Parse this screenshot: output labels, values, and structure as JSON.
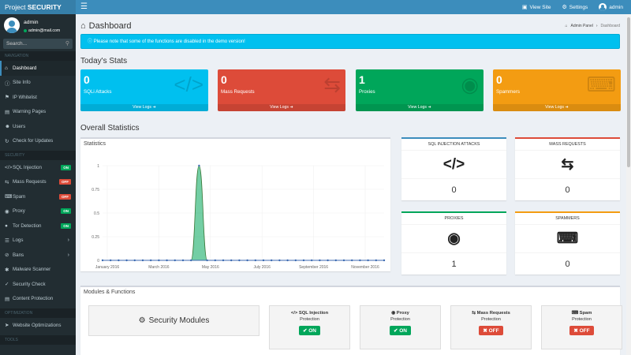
{
  "brand": {
    "prefix": "Project ",
    "strong": "SECURITY"
  },
  "topnav": {
    "toggle_icon": "menu-icon",
    "view_site": "View Site",
    "settings": "Settings",
    "user": "admin"
  },
  "user": {
    "name": "admin",
    "email": "admin@mail.com"
  },
  "search": {
    "placeholder": "Search..."
  },
  "sidebar": {
    "headers": {
      "navigation": "NAVIGATION",
      "security": "SECURITY",
      "optimization": "OPTIMIZATION",
      "tools": "TOOLS"
    },
    "nav_items": [
      {
        "label": "Dashboard",
        "icon": "home-icon"
      },
      {
        "label": "Site Info",
        "icon": "info-icon"
      },
      {
        "label": "IP Whitelist",
        "icon": "flag-icon"
      },
      {
        "label": "Warning Pages",
        "icon": "file-icon"
      },
      {
        "label": "Users",
        "icon": "users-icon"
      },
      {
        "label": "Check for Updates",
        "icon": "refresh-icon"
      }
    ],
    "security_items": [
      {
        "label": "SQL Injection",
        "badge": "ON"
      },
      {
        "label": "Mass Requests",
        "badge": "OFF"
      },
      {
        "label": "Spam",
        "badge": "OFF"
      },
      {
        "label": "Proxy",
        "badge": "ON"
      },
      {
        "label": "Tor Detection",
        "badge": "ON"
      },
      {
        "label": "Logs"
      },
      {
        "label": "Bans"
      },
      {
        "label": "Malware Scanner"
      },
      {
        "label": "Security Check"
      },
      {
        "label": "Content Protection"
      }
    ],
    "optimization_items": [
      {
        "label": "Website Optimizations"
      }
    ]
  },
  "page": {
    "title": "Dashboard",
    "breadcrumb_home": "Admin Panel",
    "breadcrumb_current": "Dashboard"
  },
  "alert": {
    "text": "Please note that some of the functions are disabled in the demo version!"
  },
  "todays_stats": {
    "title": "Today's Stats",
    "cards": [
      {
        "value": "0",
        "label": "SQLi Attacks",
        "link": "View Logs",
        "color": "#00c0ef",
        "icon": "code-icon"
      },
      {
        "value": "0",
        "label": "Mass Requests",
        "link": "View Logs",
        "color": "#dd4b39",
        "icon": "retweet-icon"
      },
      {
        "value": "1",
        "label": "Proxies",
        "link": "View Logs",
        "color": "#00a65a",
        "icon": "globe-icon"
      },
      {
        "value": "0",
        "label": "Spammers",
        "link": "View Logs",
        "color": "#f39c12",
        "icon": "keyboard-icon"
      }
    ]
  },
  "overall": {
    "title": "Overall Statistics",
    "chart_title": "Statistics",
    "mini": [
      {
        "label": "SQL INJECTION ATTACKS",
        "value": "0",
        "icon": "code-icon"
      },
      {
        "label": "MASS REQUESTS",
        "value": "0",
        "icon": "retweet-icon"
      },
      {
        "label": "PROXIES",
        "value": "1",
        "icon": "globe-icon"
      },
      {
        "label": "SPAMMERS",
        "value": "0",
        "icon": "keyboard-icon"
      }
    ]
  },
  "chart_data": {
    "type": "area",
    "title": "",
    "xlabel": "",
    "ylabel": "",
    "x_ticks": [
      "January 2016",
      "March 2016",
      "May 2016",
      "July 2016",
      "September 2016",
      "November 2016"
    ],
    "y_ticks": [
      "0",
      "0.25",
      "0.5",
      "0.75",
      "1"
    ],
    "ylim": [
      0,
      1
    ],
    "series": [
      {
        "color": "#00a65a",
        "values": [
          0,
          0,
          0,
          0,
          0,
          0,
          0,
          0,
          0,
          0,
          0,
          0,
          1,
          0,
          0,
          0,
          0,
          0,
          0,
          0,
          0,
          0,
          0,
          0,
          0,
          0,
          0,
          0,
          0,
          0,
          0,
          0,
          0,
          0,
          0,
          0
        ]
      }
    ]
  },
  "modules": {
    "title": "Modules & Functions",
    "security_modules": "Security Modules",
    "items": [
      {
        "name": "SQL Injection",
        "sub": "Protection",
        "status": "ON",
        "icon": "code-icon"
      },
      {
        "name": "Proxy",
        "sub": "Protection",
        "status": "ON",
        "icon": "globe-icon"
      },
      {
        "name": "Mass Requests",
        "sub": "Protection",
        "status": "OFF",
        "icon": "retweet-icon"
      },
      {
        "name": "Spam",
        "sub": "Protection",
        "status": "OFF",
        "icon": "keyboard-icon"
      }
    ]
  }
}
